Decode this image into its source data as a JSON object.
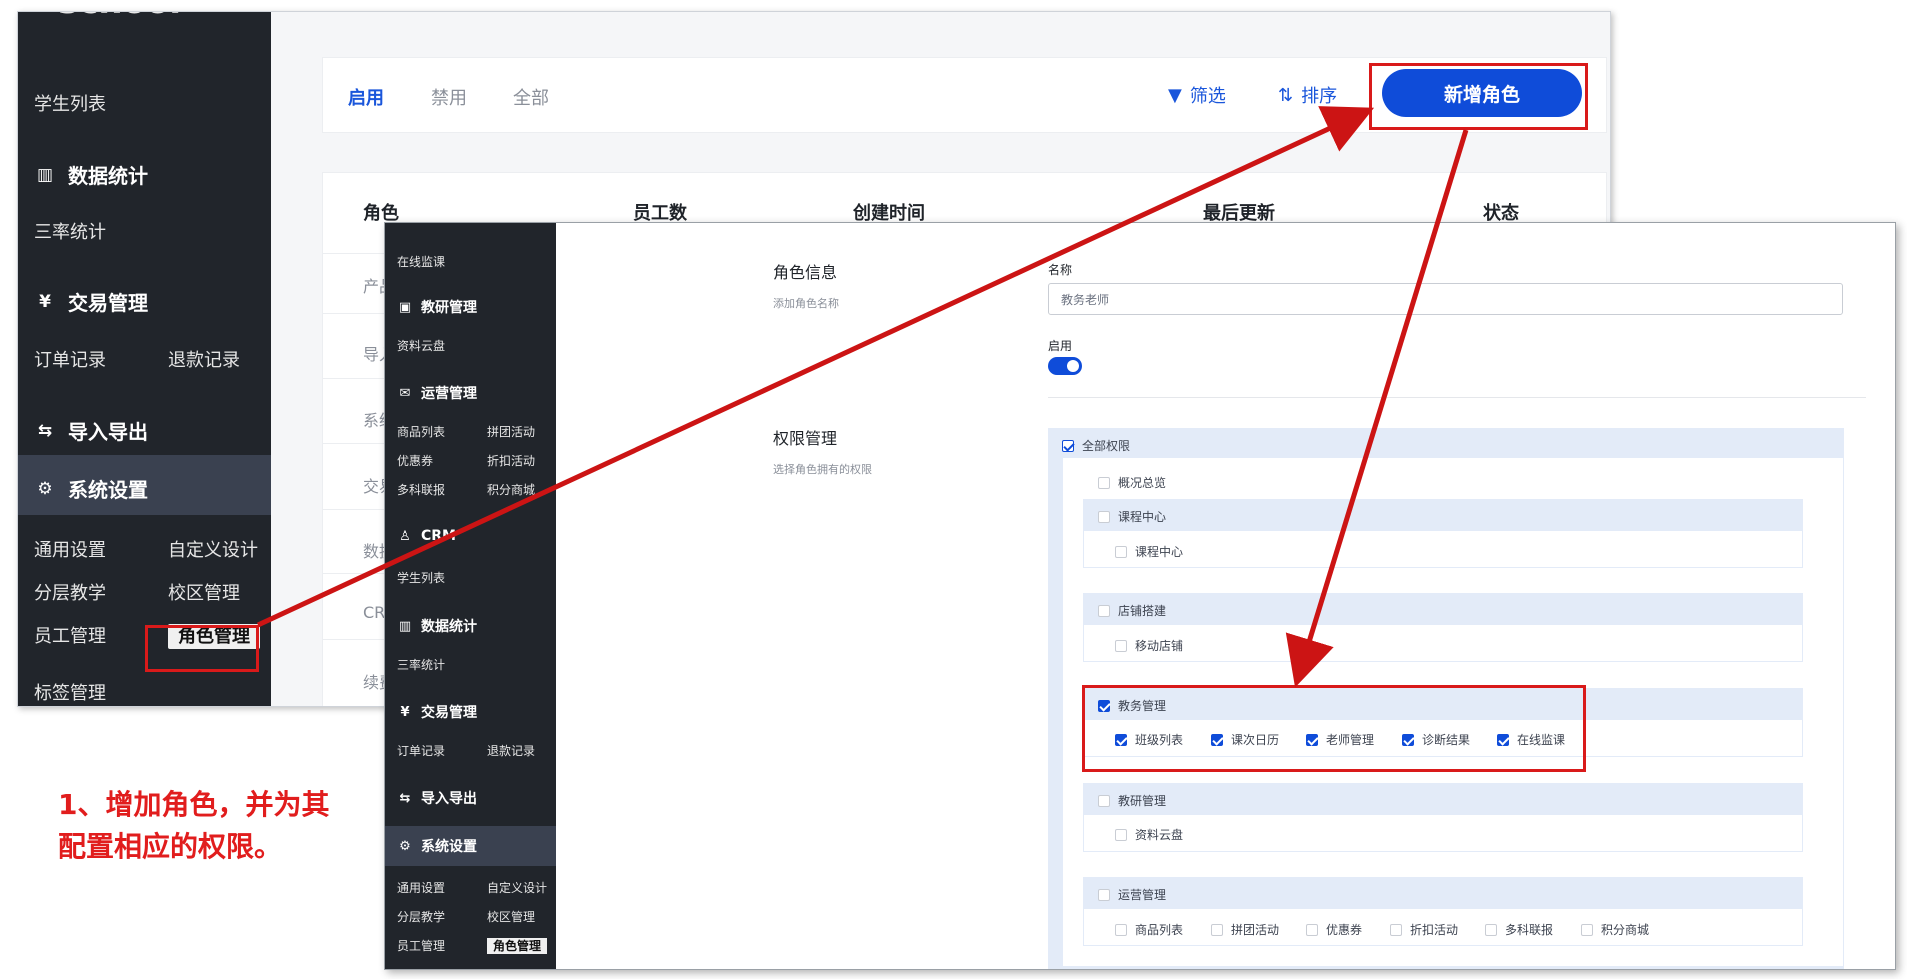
{
  "shot1": {
    "logo": "school",
    "sidebar": {
      "student_list": "学生列表",
      "data_stats": "数据统计",
      "three_rate": "三率统计",
      "trade": "交易管理",
      "orders": "订单记录",
      "refunds": "退款记录",
      "import_export": "导入导出",
      "settings": "系统设置",
      "general": "通用设置",
      "custom_design": "自定义设计",
      "layered": "分层教学",
      "campus": "校区管理",
      "staff": "员工管理",
      "role": "角色管理",
      "tags": "标签管理"
    },
    "tabs": [
      "启用",
      "禁用",
      "全部"
    ],
    "filter_label": "筛选",
    "sort_label": "排序",
    "add_role_label": "新增角色",
    "table": {
      "headers": [
        "角色",
        "员工数",
        "创建时间",
        "最后更新",
        "状态"
      ],
      "row_fragments": [
        "产品",
        "导入",
        "系统",
        "交易",
        "数据",
        "CRM",
        "续费"
      ]
    }
  },
  "shot2": {
    "sidebar": {
      "online_monitor": "在线监课",
      "research": "教研管理",
      "cloud": "资料云盘",
      "ops": "运营管理",
      "products": "商品列表",
      "group_buy": "拼团活动",
      "coupons": "优惠券",
      "discount": "折扣活动",
      "multi": "多科联报",
      "points": "积分商城",
      "crm": "CRM",
      "students": "学生列表",
      "data_stats": "数据统计",
      "three_rate": "三率统计",
      "trade": "交易管理",
      "orders": "订单记录",
      "refunds": "退款记录",
      "import_export": "导入导出",
      "settings": "系统设置",
      "general": "通用设置",
      "custom_design": "自定义设计",
      "layered": "分层教学",
      "campus": "校区管理",
      "staff": "员工管理",
      "role": "角色管理"
    },
    "role_info_title": "角色信息",
    "role_info_desc": "添加角色名称",
    "name_label": "名称",
    "name_value": "教务老师",
    "enable_label": "启用",
    "perm_title": "权限管理",
    "perm_desc": "选择角色拥有的权限",
    "all_perms": "全部权限",
    "overview": "概况总览",
    "course_center_group": "课程中心",
    "course_center_item": "课程中心",
    "store_group": "店铺搭建",
    "mobile_store": "移动店铺",
    "academic_group": "教务管理",
    "academic_items": [
      "班级列表",
      "课次日历",
      "老师管理",
      "诊断结果",
      "在线监课"
    ],
    "research_group": "教研管理",
    "research_cloud": "资料云盘",
    "ops_group": "运营管理",
    "ops_items": [
      "商品列表",
      "拼团活动",
      "优惠券",
      "折扣活动",
      "多科联报",
      "积分商城"
    ]
  },
  "caption": {
    "line1": "1、增加角色，并为其",
    "line2": "配置相应的权限。"
  },
  "colors": {
    "accent": "#0f4cd9",
    "sidebar": "#21252b",
    "annotation": "#d91a1a"
  }
}
